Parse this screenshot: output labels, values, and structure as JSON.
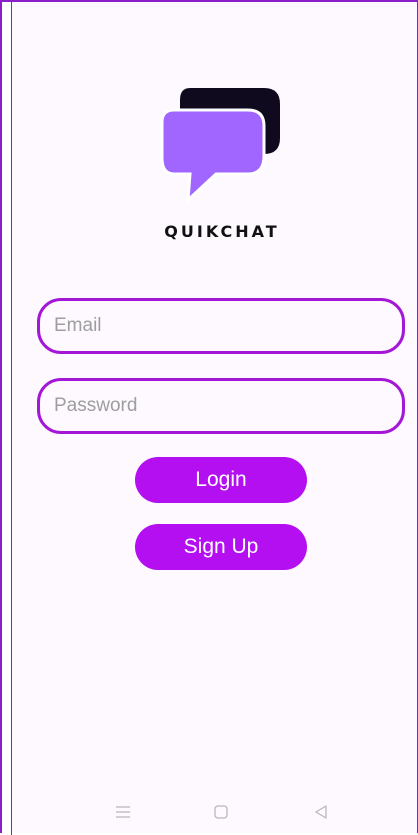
{
  "app": {
    "brand_name": "QUIKCHAT",
    "logo_icon": "chat-bubbles-icon",
    "colors": {
      "accent": "#b40ff0",
      "field_border": "#a517d6",
      "logo_back": "#0f0a1e",
      "logo_front": "#a066ff",
      "background": "#fdf9ff"
    }
  },
  "form": {
    "email_placeholder": "Email",
    "email_value": "",
    "password_placeholder": "Password",
    "password_value": "",
    "login_label": "Login",
    "signup_label": "Sign Up"
  },
  "system_nav": {
    "icons": [
      "menu-icon",
      "home-icon",
      "back-icon"
    ]
  }
}
